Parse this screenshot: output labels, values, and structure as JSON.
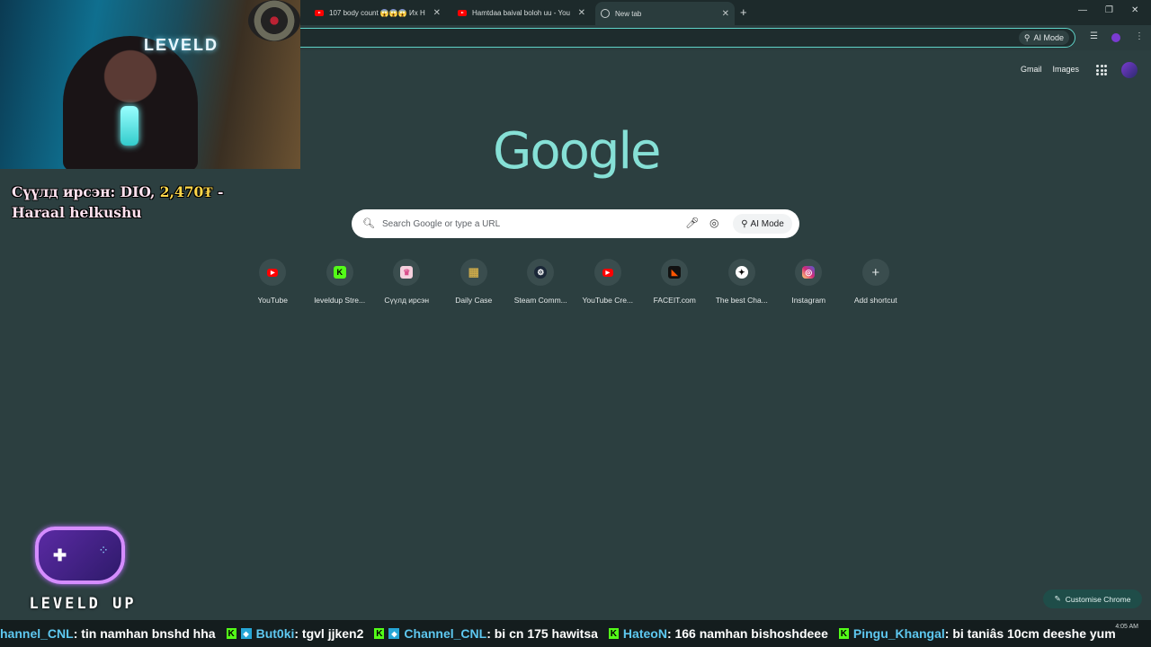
{
  "tabs": [
    {
      "title": "107 body count 😱😱😱 Их Н",
      "icon": "youtube-icon"
    },
    {
      "title": "Hamtdaa baival boloh uu - You",
      "icon": "youtube-icon"
    },
    {
      "title": "New tab",
      "icon": "chrome-icon",
      "active": true
    }
  ],
  "toolbar": {
    "ai_mode": "AI Mode"
  },
  "google": {
    "links": [
      "Gmail",
      "Images"
    ],
    "logo": "Google",
    "search_placeholder": "Search Google or type a URL",
    "ai_mode": "AI Mode"
  },
  "shortcuts": [
    {
      "label": "YouTube",
      "icon": "youtube-icon",
      "color": "#ff0000"
    },
    {
      "label": "leveldup Stre...",
      "icon": "kick-icon",
      "color": "#53fc18"
    },
    {
      "label": "Сүүлд ирсэн",
      "icon": "donation-icon",
      "color": "#d94c8a"
    },
    {
      "label": "Daily Case",
      "icon": "case-icon",
      "color": "#c9a84a"
    },
    {
      "label": "Steam Comm...",
      "icon": "steam-icon",
      "color": "#1b2838"
    },
    {
      "label": "YouTube Cre...",
      "icon": "youtube-studio-icon",
      "color": "#ff0000"
    },
    {
      "label": "FACEIT.com",
      "icon": "faceit-icon",
      "color": "#ff5500"
    },
    {
      "label": "The best Cha...",
      "icon": "chat-icon",
      "color": "#ffffff"
    },
    {
      "label": "Instagram",
      "icon": "instagram-icon",
      "color": "#d62976"
    },
    {
      "label": "Add shortcut",
      "icon": "plus-icon",
      "color": "#e3e8e8"
    }
  ],
  "customise": "Customise Chrome",
  "donation": {
    "prefix": "Сүүлд ирсэн: DIO, ",
    "amount": "2,470₮",
    "suffix": " - Haraal helkushu"
  },
  "stream_logo": "LEVELD UP",
  "webcam_sign": "LEVELD",
  "chat": {
    "lead_user": "hannel_CNL",
    "lead_text": " : tin namhan bnshd hha",
    "messages": [
      {
        "user": "But0ki",
        "text": " : tgvl jjken2"
      },
      {
        "user": "Channel_CNL",
        "text": " : bi cn 175 hawitsa"
      },
      {
        "user": "HateoN",
        "text": " : 166 namhan bishoshdeee"
      },
      {
        "user": "Pingu_Khangal",
        "text": " : bi taniâs 10cm deeshe yum"
      }
    ]
  },
  "clock": "4:05 AM"
}
